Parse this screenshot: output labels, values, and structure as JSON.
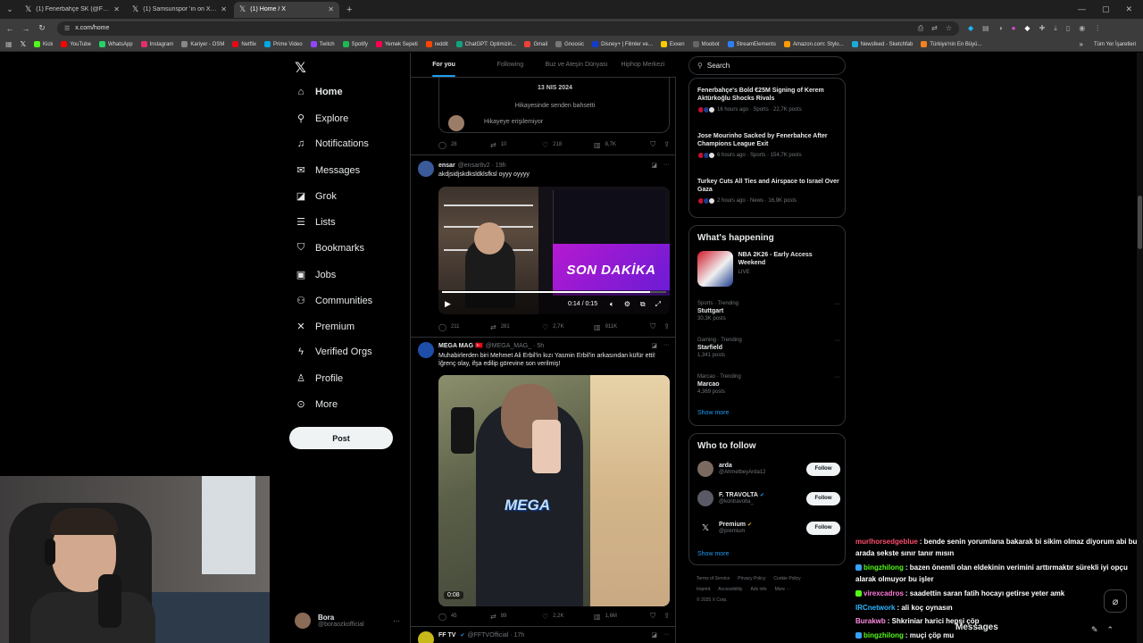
{
  "browser": {
    "tabs": [
      {
        "title": "(1) Fenerbahçe SK (@Fenerbah",
        "active": false
      },
      {
        "title": "(1) Samsunspor 'ın on X: \"Kura",
        "active": false
      },
      {
        "title": "(1) Home / X",
        "active": true
      }
    ],
    "url": "x.com/home",
    "bookmarks": [
      {
        "label": "Kick",
        "color": "#53fc18"
      },
      {
        "label": "YouTube",
        "color": "#ff0000"
      },
      {
        "label": "WhatsApp",
        "color": "#25d366"
      },
      {
        "label": "Instagram",
        "color": "#e1306c"
      },
      {
        "label": "Kariyer - OSM",
        "color": "#888888"
      },
      {
        "label": "Netflix",
        "color": "#e50914"
      },
      {
        "label": "Prime Video",
        "color": "#00a8e1"
      },
      {
        "label": "Twitch",
        "color": "#9146ff"
      },
      {
        "label": "Spotify",
        "color": "#1db954"
      },
      {
        "label": "Yemek Sepeti",
        "color": "#fa0050"
      },
      {
        "label": "reddit",
        "color": "#ff4500"
      },
      {
        "label": "ChatGPT: Optimizin...",
        "color": "#10a37f"
      },
      {
        "label": "Gmail",
        "color": "#ea4335"
      },
      {
        "label": "Gnoosic",
        "color": "#777777"
      },
      {
        "label": "Disney+ | Filmler ve...",
        "color": "#113ccf"
      },
      {
        "label": "Exxen",
        "color": "#ffcc00"
      },
      {
        "label": "Moobot",
        "color": "#666666"
      },
      {
        "label": "StreamElements",
        "color": "#2d7ff9"
      },
      {
        "label": "Amazon.com: Stylo...",
        "color": "#ff9900"
      },
      {
        "label": "Newsfeed - Sketchfab",
        "color": "#1caad9"
      },
      {
        "label": "Türkiye'nin En Büyü...",
        "color": "#f58220"
      }
    ],
    "all_bookmarks": "Tüm Yer İşaretleri"
  },
  "nav": {
    "items": [
      {
        "label": "Home",
        "icon": "home-icon",
        "glyph": "⌂",
        "bold": true
      },
      {
        "label": "Explore",
        "icon": "search-icon",
        "glyph": "⚲",
        "bold": false
      },
      {
        "label": "Notifications",
        "icon": "bell-icon",
        "glyph": "♫",
        "bold": false
      },
      {
        "label": "Messages",
        "icon": "mail-icon",
        "glyph": "✉",
        "bold": false
      },
      {
        "label": "Grok",
        "icon": "grok-icon",
        "glyph": "◪",
        "bold": false
      },
      {
        "label": "Lists",
        "icon": "list-icon",
        "glyph": "☰",
        "bold": false
      },
      {
        "label": "Bookmarks",
        "icon": "bookmark-icon",
        "glyph": "⛉",
        "bold": false
      },
      {
        "label": "Jobs",
        "icon": "briefcase-icon",
        "glyph": "▣",
        "bold": false
      },
      {
        "label": "Communities",
        "icon": "people-icon",
        "glyph": "⚇",
        "bold": false
      },
      {
        "label": "Premium",
        "icon": "x-premium-icon",
        "glyph": "✕",
        "bold": false
      },
      {
        "label": "Verified Orgs",
        "icon": "lightning-icon",
        "glyph": "ϟ",
        "bold": false
      },
      {
        "label": "Profile",
        "icon": "person-icon",
        "glyph": "♙",
        "bold": false
      },
      {
        "label": "More",
        "icon": "more-circle-icon",
        "glyph": "⊙",
        "bold": false
      }
    ],
    "post_label": "Post",
    "account": {
      "name": "Bora",
      "handle": "@boraozkofficial"
    }
  },
  "feed": {
    "tabs": [
      "For you",
      "Following",
      "Buz ve Ateşin Dünyası",
      "Hiphop Merkezi"
    ],
    "quote": {
      "date": "13 NIS 2024",
      "story_text": "Hikayesinde senden bahsetti",
      "unavailable": "Hikayeye erişilemiyor"
    },
    "tweets": [
      {
        "stats": {
          "replies": "28",
          "reposts": "10",
          "likes": "218",
          "views": "8,7K"
        }
      },
      {
        "name": "ensar",
        "handle": "@ensar8v2 · 19h",
        "text": "akdjsidjskdksldklsfksl oyyy oyyyy",
        "media": {
          "banner": "SON DAKİKA",
          "time": "0:14 / 0:15",
          "progress": 0.93
        },
        "stats": {
          "replies": "211",
          "reposts": "281",
          "likes": "2,7K",
          "views": "911K"
        }
      },
      {
        "name": "MEGA MAG 🇹🇷",
        "handle": "@MEGA_MAG_ · 5h",
        "text": "Muhabirlerden biri Mehmet Ali Erbil'in kızı Yasmin Erbil'in arkasından küfür etti! İğrenç olay, ifşa edilip görevine son verilmiş!",
        "media": {
          "brand": "MEGA",
          "time": "0:08"
        },
        "stats": {
          "replies": "45",
          "reposts": "89",
          "likes": "2,2K",
          "views": "1,6M"
        }
      },
      {
        "name": "FF TV",
        "handle": "@FFTVOfficial · 17h"
      }
    ]
  },
  "right": {
    "search_placeholder": "Search",
    "news": [
      {
        "title": "Fenerbahçe's Bold €25M Signing of Kerem Aktürkoğlu Shocks Rivals",
        "meta": "16 hours ago · Sports · 22,7K posts"
      },
      {
        "title": "Jose Mourinho Sacked by Fenerbahce After Champions League Exit",
        "meta": "6 hours ago · Sports · 154,7K posts"
      },
      {
        "title": "Turkey Cuts All Ties and Airspace to Israel Over Gaza",
        "meta": "2 hours ago · News · 16,9K posts"
      }
    ],
    "happening_title": "What's happening",
    "featured": {
      "title": "NBA 2K26 - Early Access Weekend",
      "label": "LIVE"
    },
    "trends": [
      {
        "category": "Sports · Trending",
        "name": "Stuttgart",
        "posts": "30,3K posts"
      },
      {
        "category": "Gaming · Trending",
        "name": "Starfield",
        "posts": "1,341 posts"
      },
      {
        "category": "Marcao · Trending",
        "name": "Marcao",
        "posts": "4,369 posts"
      }
    ],
    "show_more": "Show more",
    "wtf_title": "Who to follow",
    "follow_label": "Follow",
    "suggestions": [
      {
        "name": "arda",
        "handle": "@AhmetbeyArda12",
        "verified": false,
        "avatar_color": "#7a6a60"
      },
      {
        "name": "F. TRAVOLTA",
        "handle": "@kontravolta_",
        "verified": true,
        "avatar_color": "#5a5a66"
      },
      {
        "name": "Premium",
        "handle": "@premium",
        "verified": "gold",
        "avatar_color": "#000000"
      }
    ],
    "footer": [
      "Terms of Service",
      "Privacy Policy",
      "Cookie Policy",
      "Imprint",
      "Accessibility",
      "Ads info",
      "More ···",
      "© 2025 X Corp."
    ]
  },
  "chat": {
    "lines": [
      {
        "user": "murlhorsedgeblue",
        "color": "#ff4d6d",
        "msg": ": bende senin yorumlarıa bakarak bi sikim olmaz diyorum abi bu arada sekste sınır tanır mısın",
        "badge": ""
      },
      {
        "user": "bingzhilong",
        "color": "#53fc18",
        "msg": ": bazen önemli olan eldekinin verimini arttırmaktır sürekli iyi opçu alarak olmuyor bu işler",
        "badge": "#3aa0ff"
      },
      {
        "user": "virexcadros",
        "color": "#ff7ad9",
        "msg": ": saadettin saran fatih hocayı getirse yeter amk",
        "badge": "#53fc18"
      },
      {
        "user": "IRCnetwork",
        "color": "#2db7ff",
        "msg": ": ali koç oynasın",
        "badge": ""
      },
      {
        "user": "Burakwb",
        "color": "#ff8ae0",
        "msg": ": Shkriniar harici hepsi çöp",
        "badge": ""
      },
      {
        "user": "bingzhilong",
        "color": "#53fc18",
        "msg": ": muçi çöp mu",
        "badge": "#3aa0ff"
      }
    ],
    "messages_label": "Messages"
  }
}
